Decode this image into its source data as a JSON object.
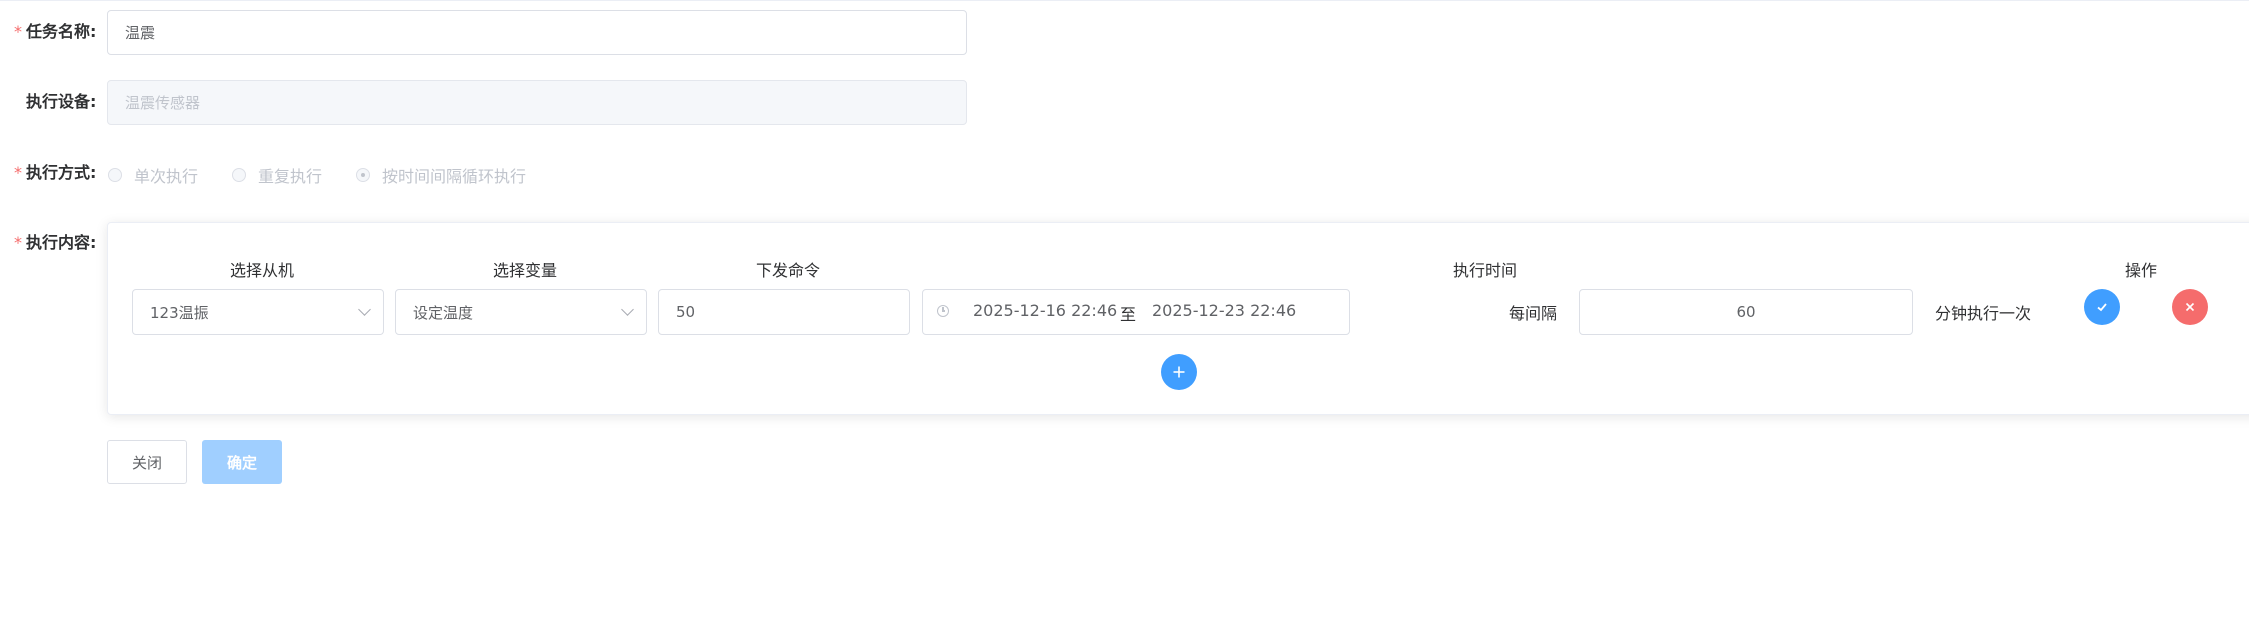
{
  "form": {
    "task_name": {
      "required": "*",
      "label": "任务名称:",
      "value": "温震"
    },
    "device": {
      "label": "执行设备:",
      "value": "温震传感器"
    },
    "mode": {
      "required": "*",
      "label": "执行方式:",
      "options": [
        "单次执行",
        "重复执行",
        "按时间间隔循环执行"
      ],
      "selected": "按时间间隔循环执行"
    },
    "content": {
      "required": "*",
      "label": "执行内容:"
    }
  },
  "table": {
    "headers": {
      "slave": "选择从机",
      "variable": "选择变量",
      "command": "下发命令",
      "time": "执行时间",
      "actions": "操作"
    },
    "row": {
      "slave": "123温振",
      "variable": "设定温度",
      "command": "50",
      "start_time": "2025-12-16 22:46",
      "range_separator": "至",
      "end_time": "2025-12-23 22:46",
      "interval_prefix": "每间隔",
      "interval": "60",
      "interval_suffix": "分钟执行一次"
    }
  },
  "buttons": {
    "close": "关闭",
    "confirm": "确定"
  },
  "colors": {
    "primary": "#409eff",
    "danger": "#f56c6c",
    "confirm_disabled": "#a0cfff"
  }
}
